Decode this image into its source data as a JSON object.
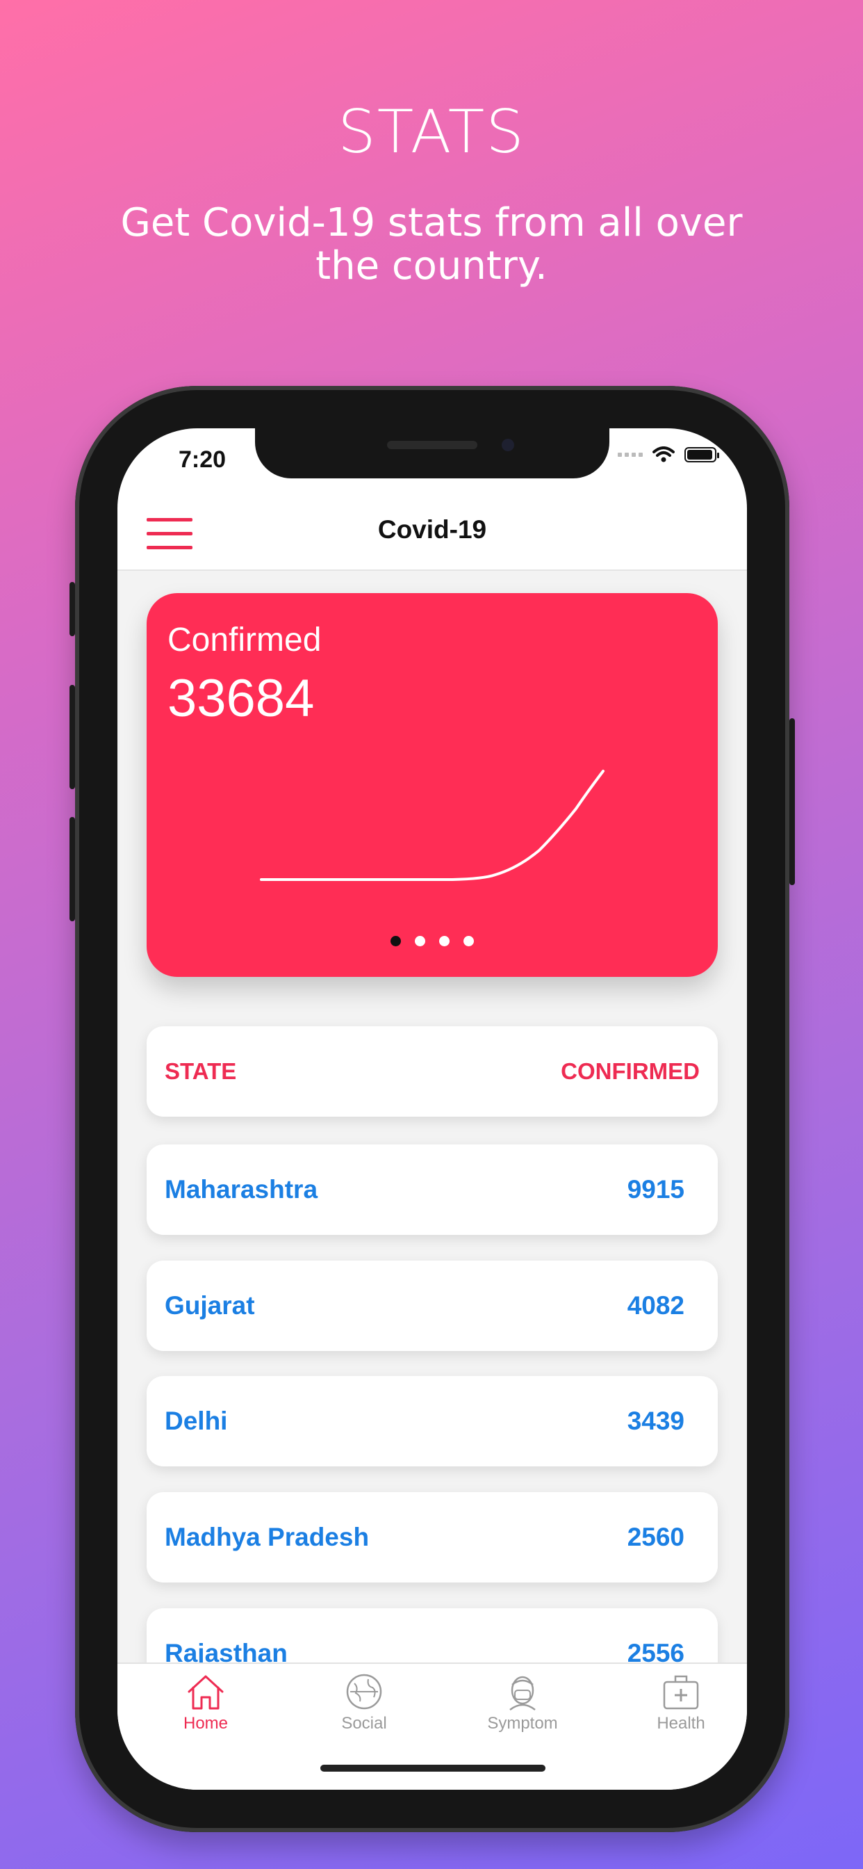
{
  "promo": {
    "title": "STATS",
    "subtitle": "Get Covid-19 stats from all over the country."
  },
  "status_bar": {
    "time": "7:20"
  },
  "navbar": {
    "title": "Covid-19"
  },
  "card": {
    "label": "Confirmed",
    "value": "33684",
    "color": "#ff2d55",
    "page_count": 4,
    "active_page": 1
  },
  "table": {
    "header_left": "STATE",
    "header_right": "CONFIRMED",
    "rows": [
      {
        "state": "Maharashtra",
        "confirmed": "9915"
      },
      {
        "state": "Gujarat",
        "confirmed": "4082"
      },
      {
        "state": "Delhi",
        "confirmed": "3439"
      },
      {
        "state": "Madhya Pradesh",
        "confirmed": "2560"
      },
      {
        "state": "Rajasthan",
        "confirmed": "2556"
      }
    ]
  },
  "tabs": [
    {
      "label": "Home",
      "icon": "home-icon",
      "active": true
    },
    {
      "label": "Social",
      "icon": "globe-icon",
      "active": false
    },
    {
      "label": "Symptom",
      "icon": "masked-face-icon",
      "active": false
    },
    {
      "label": "Health",
      "icon": "first-aid-kit-icon",
      "active": false
    }
  ],
  "colors": {
    "accent": "#ee2b52",
    "link": "#1b7fe3"
  }
}
